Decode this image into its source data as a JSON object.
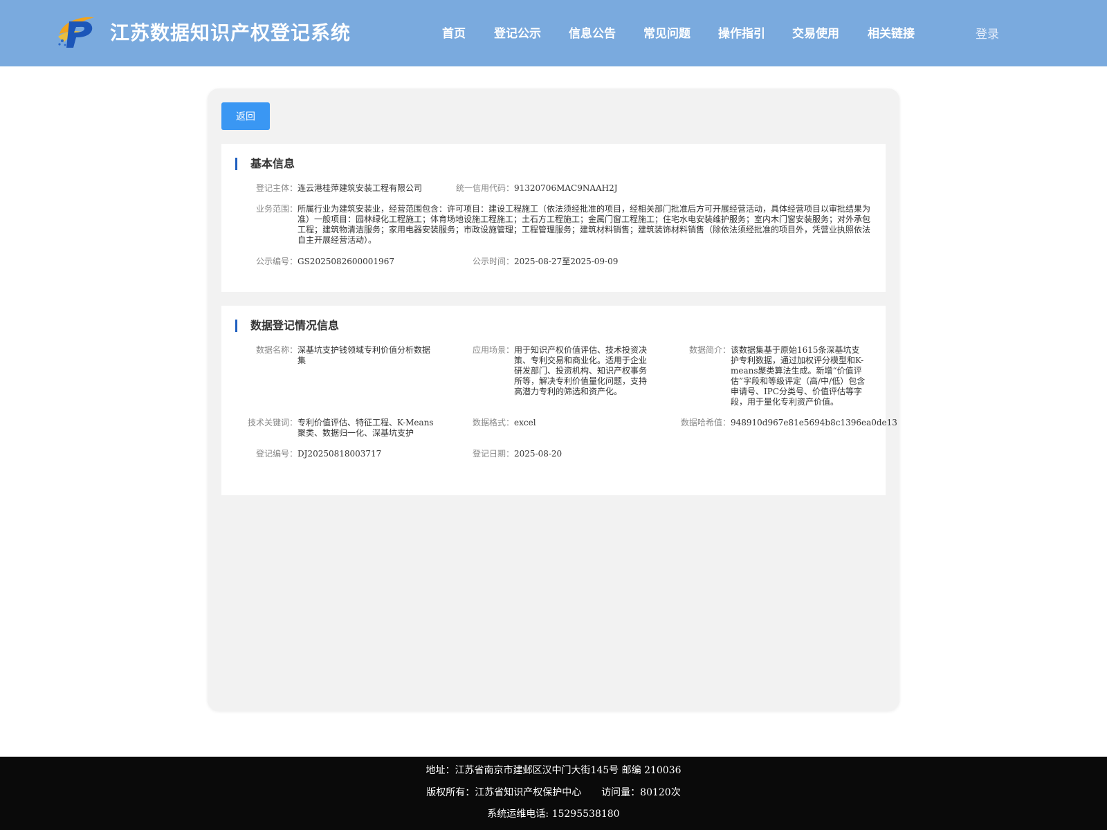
{
  "header": {
    "title": "江苏数据知识产权登记系统",
    "nav": [
      "首页",
      "登记公示",
      "信息公告",
      "常见问题",
      "操作指引",
      "交易使用",
      "相关链接"
    ],
    "login": "登录"
  },
  "main": {
    "back_label": "返回",
    "basic_info": {
      "section_title": "基本信息",
      "subject_label": "登记主体：",
      "subject_value": "连云港桂萍建筑安装工程有限公司",
      "credit_label": "统一信用代码：",
      "credit_value": "91320706MAC9NAAH2J",
      "scope_label": "业务范围：",
      "scope_value": "所属行业为建筑安装业，经营范围包含：许可项目：建设工程施工（依法须经批准的项目，经相关部门批准后方可开展经营活动，具体经营项目以审批结果为准）一般项目：园林绿化工程施工；体育场地设施工程施工；土石方工程施工；金属门窗工程施工；住宅水电安装维护服务；室内木门窗安装服务；对外承包工程；建筑物清洁服务；家用电器安装服务；市政设施管理；工程管理服务；建筑材料销售；建筑装饰材料销售（除依法须经批准的项目外，凭营业执照依法自主开展经营活动）。",
      "pub_no_label": "公示编号：",
      "pub_no_value": "GS2025082600001967",
      "pub_time_label": "公示时间：",
      "pub_time_value": "2025-08-27至2025-09-09"
    },
    "data_info": {
      "section_title": "数据登记情况信息",
      "name_label": "数据名称：",
      "name_value": "深基坑支护钱领域专利价值分析数据集",
      "scene_label": "应用场景：",
      "scene_value": "用于知识产权价值评估、技术投资决策、专利交易和商业化。适用于企业研发部门、投资机构、知识产权事务所等，解决专利价值量化问题，支持高潜力专利的筛选和资产化。",
      "intro_label": "数据简介：",
      "intro_value": "该数据集基于原始1615条深基坑支护专利数据，通过加权评分模型和K-means聚类算法生成。新增“价值评估”字段和等级评定（高/中/低）包含申请号、IPC分类号、价值评估等字段，用于量化专利资产价值。",
      "keywords_label": "技术关键词：",
      "keywords_value": "专利价值评估、特征工程、K-Means聚类、数据归一化、深基坑支护",
      "format_label": "数据格式：",
      "format_value": "excel",
      "hash_label": "数据哈希值：",
      "hash_value": "948910d967e81e5694b8c1396ea0de13",
      "reg_no_label": "登记编号：",
      "reg_no_value": "DJ20250818003717",
      "reg_date_label": "登记日期：",
      "reg_date_value": "2025-08-20"
    }
  },
  "footer": {
    "address": "地址：江苏省南京市建邺区汉中门大街145号 邮编 210036",
    "copyright": "版权所有：江苏省知识产权保护中心",
    "visits": "访问量：80120次",
    "phone": "系统运维电话: 15295538180"
  },
  "colors": {
    "header_bg": "#7aaade",
    "button_bg": "#3a97f3",
    "section_bar": "#1f5fbf",
    "footer_bg": "#0a0a0a"
  }
}
